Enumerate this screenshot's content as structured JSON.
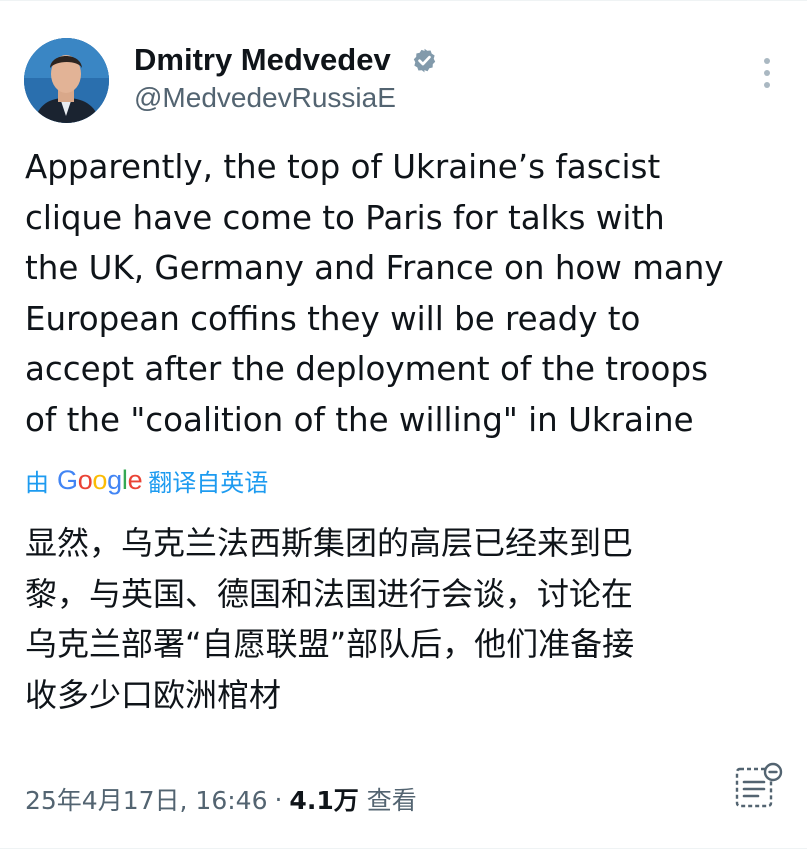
{
  "author": {
    "name": "Dmitry Medvedev",
    "handle": "@MedvedevRussiaE",
    "verified": true,
    "avatar": "avatar-photo"
  },
  "tweet": {
    "text": "Apparently, the top of Ukraine’s fascist\nclique have come to Paris for talks with\nthe UK, Germany and France on how many\nEuropean coffins they will be ready to\naccept after the deployment of the troops\nof the \"coalition of the willing\" in Ukraine"
  },
  "translation": {
    "prefix": "由",
    "provider": "Google",
    "suffix": "翻译自英语",
    "text": "显然，乌克兰法西斯集团的高层已经来到巴\n黎，与英国、德国和法国进行会谈，讨论在\n乌克兰部署“自愿联盟”部队后，他们准备接\n收多少口欧洲棺材"
  },
  "meta": {
    "timestamp": "25年4月17日, 16:46",
    "separator": "·",
    "views_count": "4.1万",
    "views_label": "查看"
  },
  "icons": {
    "verified": "verified-badge-icon",
    "more": "more-options-icon",
    "analytics": "post-analytics-icon"
  },
  "colors": {
    "link": "#1d9bf0",
    "text": "#0f1419",
    "secondary": "#536471",
    "border": "#eff3f4"
  }
}
